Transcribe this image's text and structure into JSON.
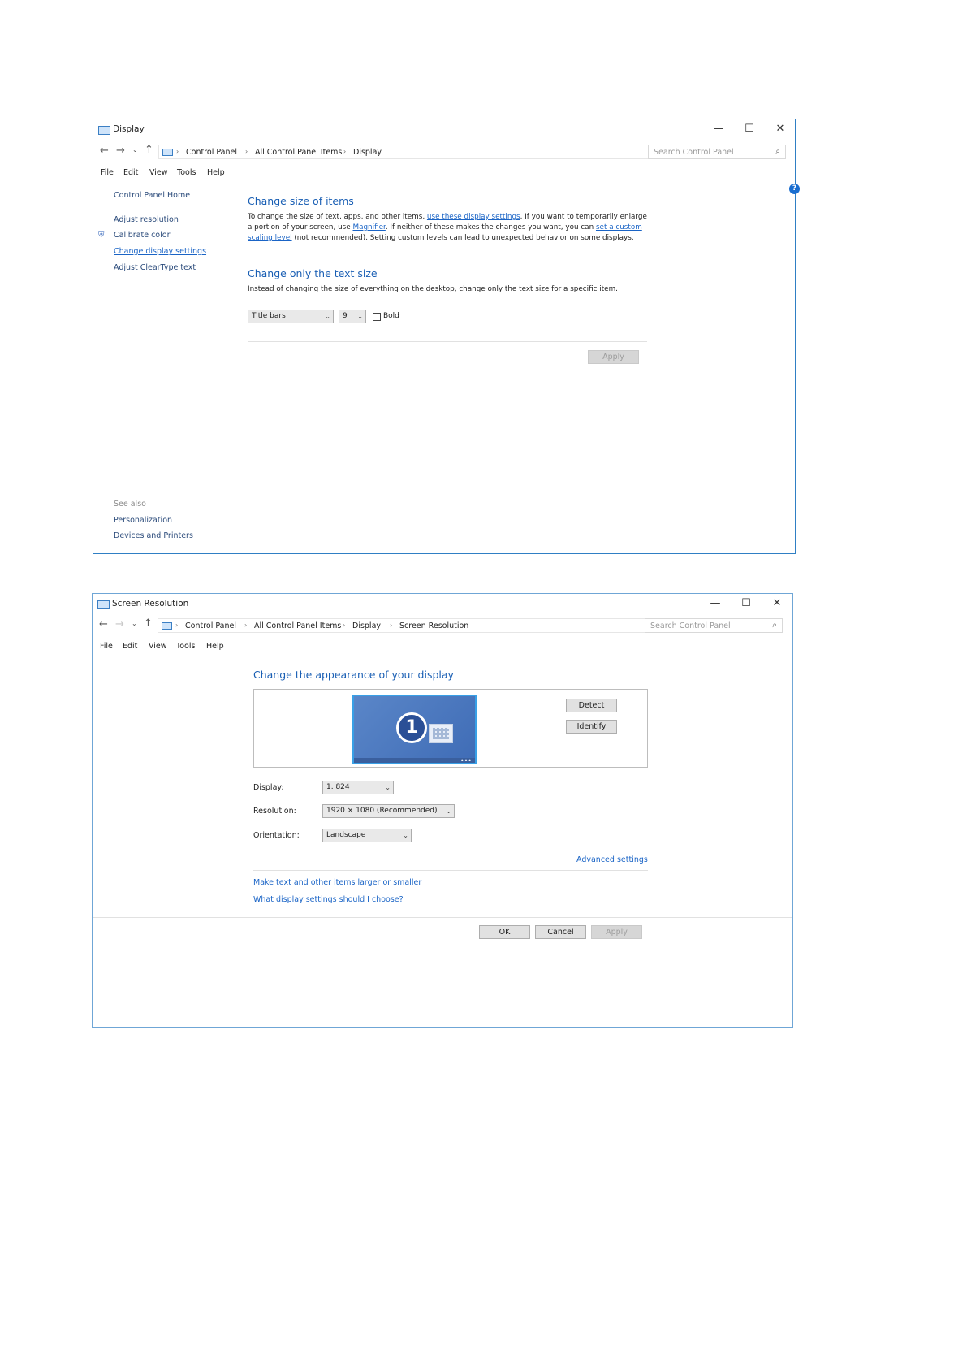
{
  "display_window": {
    "title": "Display",
    "controls": {
      "minimize": "—",
      "maximize": "☐",
      "close": "✕"
    },
    "breadcrumb": [
      "Control Panel",
      "All Control Panel Items",
      "Display"
    ],
    "search_placeholder": "Search Control Panel",
    "menu": [
      "File",
      "Edit",
      "View",
      "Tools",
      "Help"
    ],
    "sidebar": {
      "home": "Control Panel Home",
      "items": [
        "Adjust resolution",
        "Calibrate color",
        "Change display settings",
        "Adjust ClearType text"
      ],
      "see_also_label": "See also",
      "see_also": [
        "Personalization",
        "Devices and Printers"
      ]
    },
    "section1": {
      "heading": "Change size of items",
      "p1_a": "To change the size of text, apps, and other items, ",
      "p1_link1": "use these display settings",
      "p1_b": ". If you want to temporarily enlarge",
      "p2_a": "a portion of your screen, use ",
      "p2_link2": "Magnifier",
      "p2_b": ". If neither of these makes the changes you want, you can ",
      "p2_link3a": "set a custom",
      "p3_link3b": "scaling level",
      "p3_b": " (not recommended). Setting custom levels can lead to unexpected behavior on some displays."
    },
    "section2": {
      "heading": "Change only the text size",
      "text": "Instead of changing the size of everything on the desktop, change only the text size for a specific item.",
      "item_select": "Title bars",
      "size_select": "9",
      "bold_label": "Bold"
    },
    "apply": "Apply"
  },
  "resolution_window": {
    "title": "Screen Resolution",
    "controls": {
      "minimize": "—",
      "maximize": "☐",
      "close": "✕"
    },
    "breadcrumb": [
      "Control Panel",
      "All Control Panel Items",
      "Display",
      "Screen Resolution"
    ],
    "search_placeholder": "Search Control Panel",
    "menu": [
      "File",
      "Edit",
      "View",
      "Tools",
      "Help"
    ],
    "heading": "Change the appearance of your display",
    "monitor_number": "1",
    "detect": "Detect",
    "identify": "Identify",
    "display_label": "Display:",
    "display_value": "1. 824",
    "resolution_label": "Resolution:",
    "resolution_value": "1920 × 1080 (Recommended)",
    "orientation_label": "Orientation:",
    "orientation_value": "Landscape",
    "advanced": "Advanced settings",
    "link1": "Make text and other items larger or smaller",
    "link2": "What display settings should I choose?",
    "ok": "OK",
    "cancel": "Cancel",
    "apply": "Apply"
  }
}
